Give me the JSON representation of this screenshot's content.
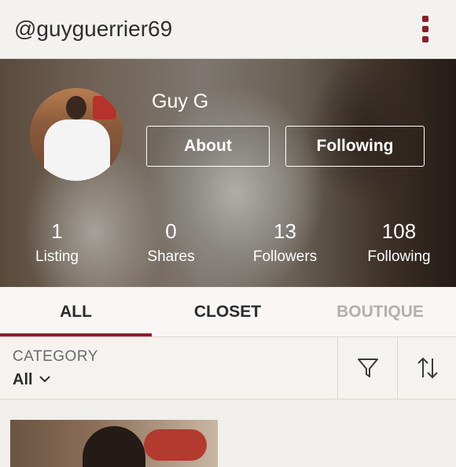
{
  "header": {
    "handle": "@guyguerrier69",
    "menu_icon": "more-vert-icon"
  },
  "profile": {
    "name": "Guy G",
    "about_label": "About",
    "following_label": "Following",
    "stats": [
      {
        "value": "1",
        "label": "Listing"
      },
      {
        "value": "0",
        "label": "Shares"
      },
      {
        "value": "13",
        "label": "Followers"
      },
      {
        "value": "108",
        "label": "Following"
      }
    ]
  },
  "tabs": [
    {
      "label": "ALL",
      "active": true
    },
    {
      "label": "CLOSET",
      "active": false
    },
    {
      "label": "BOUTIQUE",
      "active": false
    }
  ],
  "filters": {
    "category_label": "CATEGORY",
    "category_value": "All",
    "filter_icon": "filter-icon",
    "sort_icon": "sort-icon"
  },
  "colors": {
    "accent": "#8c1f2b",
    "muted_tab": "#b3b0ab"
  }
}
